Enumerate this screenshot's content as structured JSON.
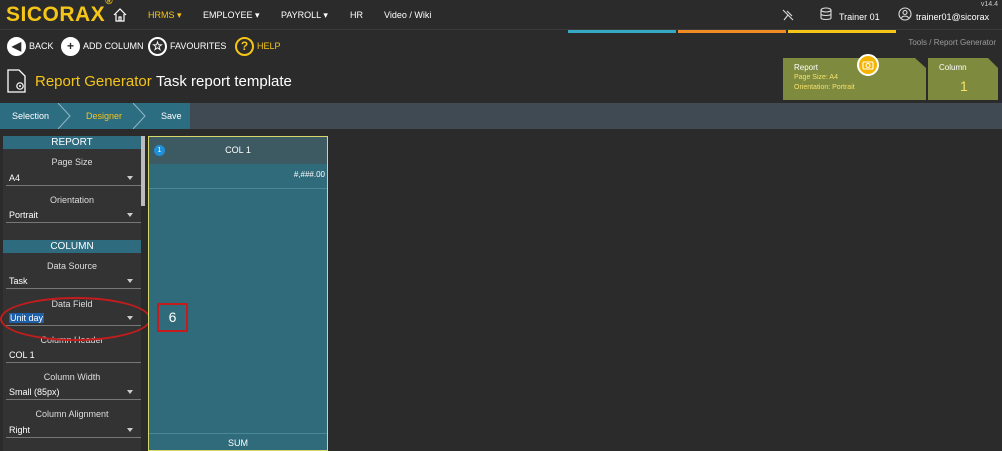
{
  "app": {
    "logo": "SICORAX",
    "logo_mark": "®",
    "version": "v14.4"
  },
  "nav": {
    "items": [
      {
        "label": "HRMS ▾"
      },
      {
        "label": "EMPLOYEE ▾"
      },
      {
        "label": "PAYROLL ▾"
      },
      {
        "label": "HR"
      },
      {
        "label": "Video / Wiki"
      }
    ],
    "db_user": "Trainer 01",
    "account": "trainer01@sicorax"
  },
  "strip_colors": [
    "#36a9c4",
    "#f08a24",
    "#f5c518"
  ],
  "toolbar": {
    "back": "BACK",
    "add_column": "ADD COLUMN",
    "favourites": "FAVOURITES",
    "help": "HELP"
  },
  "breadcrumb": {
    "root": "Tools",
    "sep": "/",
    "current": "Report Generator"
  },
  "page": {
    "title": "Report Generator",
    "subtitle": "Task report template"
  },
  "report_card": {
    "title": "Report",
    "page_size": "Page Size: A4",
    "orientation": "Orientation: Portrait"
  },
  "column_card": {
    "title": "Column",
    "count": "1"
  },
  "wizard": {
    "steps": [
      "Selection",
      "Designer",
      "Save"
    ],
    "active_index": 1
  },
  "panel": {
    "report_header": "REPORT",
    "page_size_label": "Page Size",
    "page_size_value": "A4",
    "orientation_label": "Orientation",
    "orientation_value": "Portrait",
    "column_header": "COLUMN",
    "data_source_label": "Data Source",
    "data_source_value": "Task",
    "data_field_label": "Data Field",
    "data_field_value": "Unit day",
    "column_header_label": "Column Header",
    "column_header_value": "COL 1",
    "column_width_label": "Column Width",
    "column_width_value": "Small (85px)",
    "column_alignment_label": "Column Alignment",
    "column_alignment_value": "Right"
  },
  "canvas": {
    "column_index": "1",
    "column_title": "COL 1",
    "format": "#,###.00",
    "footer": "SUM"
  },
  "annotation": {
    "step_number": "6"
  }
}
